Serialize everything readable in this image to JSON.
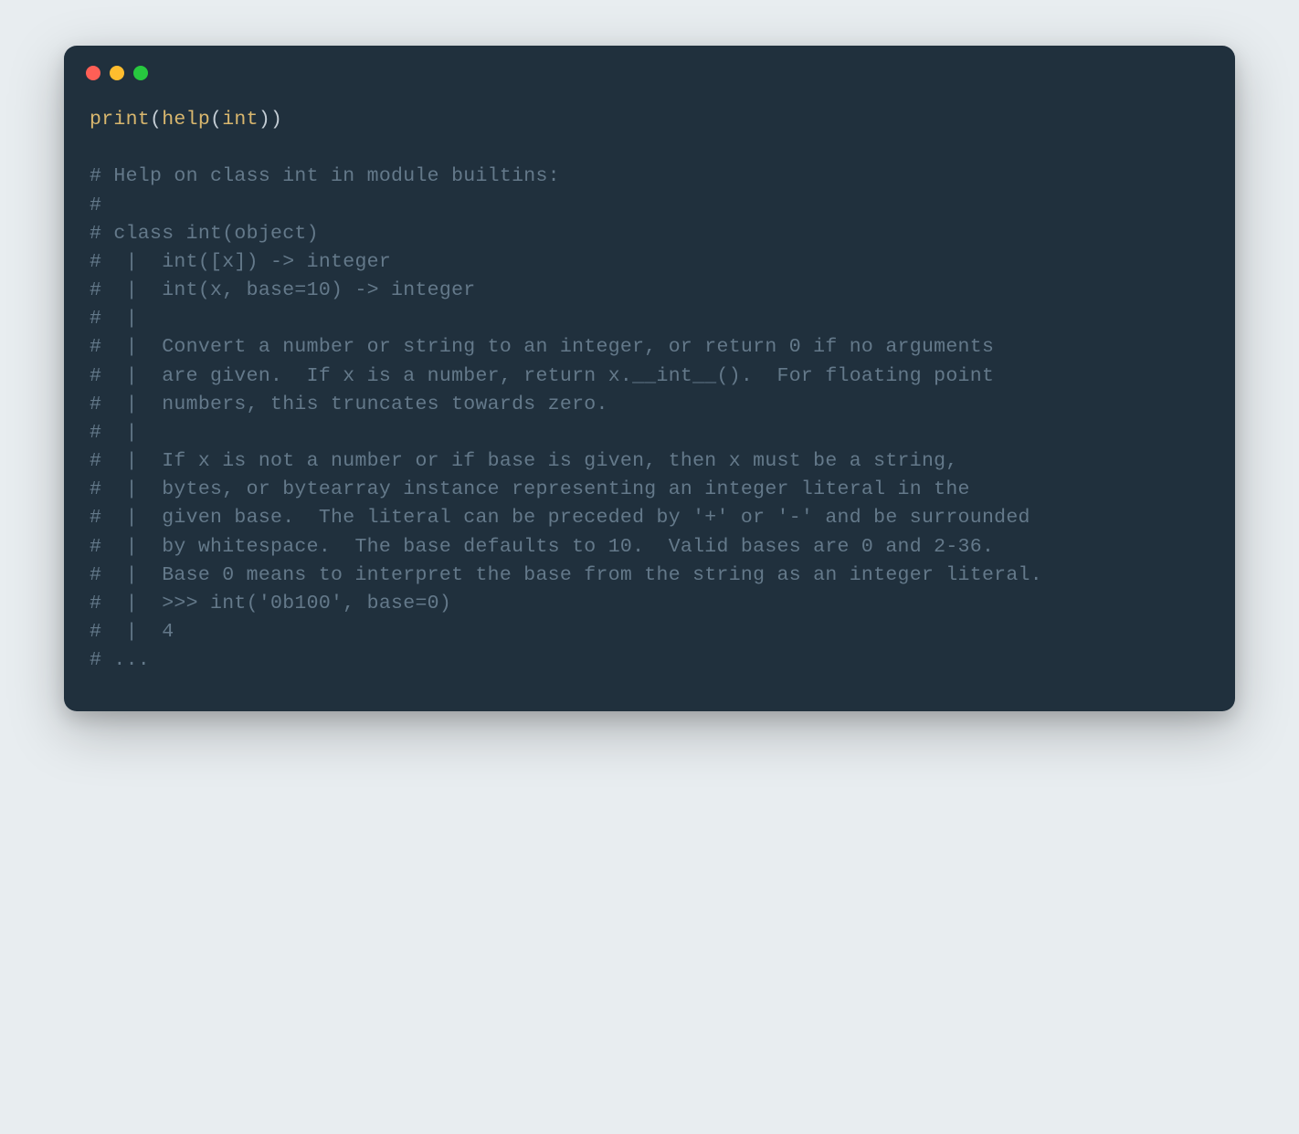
{
  "colors": {
    "background": "#e8edf0",
    "window": "#20303d",
    "builtin": "#d9b76e",
    "default": "#c4cdd5",
    "comment": "#64798a",
    "dot_red": "#ff5f56",
    "dot_yellow": "#ffbd2e",
    "dot_green": "#27c93f"
  },
  "code": {
    "tokens": {
      "t0": "print",
      "t1": "(",
      "t2": "help",
      "t3": "(",
      "t4": "int",
      "t5": "))"
    }
  },
  "comments": {
    "c0": "# Help on class int in module builtins:",
    "c1": "#",
    "c2": "# class int(object)",
    "c3": "#  |  int([x]) -> integer",
    "c4": "#  |  int(x, base=10) -> integer",
    "c5": "#  |",
    "c6": "#  |  Convert a number or string to an integer, or return 0 if no arguments",
    "c7": "#  |  are given.  If x is a number, return x.__int__().  For floating point",
    "c8": "#  |  numbers, this truncates towards zero.",
    "c9": "#  |",
    "c10": "#  |  If x is not a number or if base is given, then x must be a string,",
    "c11": "#  |  bytes, or bytearray instance representing an integer literal in the",
    "c12": "#  |  given base.  The literal can be preceded by '+' or '-' and be surrounded",
    "c13": "#  |  by whitespace.  The base defaults to 10.  Valid bases are 0 and 2-36.",
    "c14": "#  |  Base 0 means to interpret the base from the string as an integer literal.",
    "c15": "#  |  >>> int('0b100', base=0)",
    "c16": "#  |  4",
    "c17": "# ..."
  }
}
